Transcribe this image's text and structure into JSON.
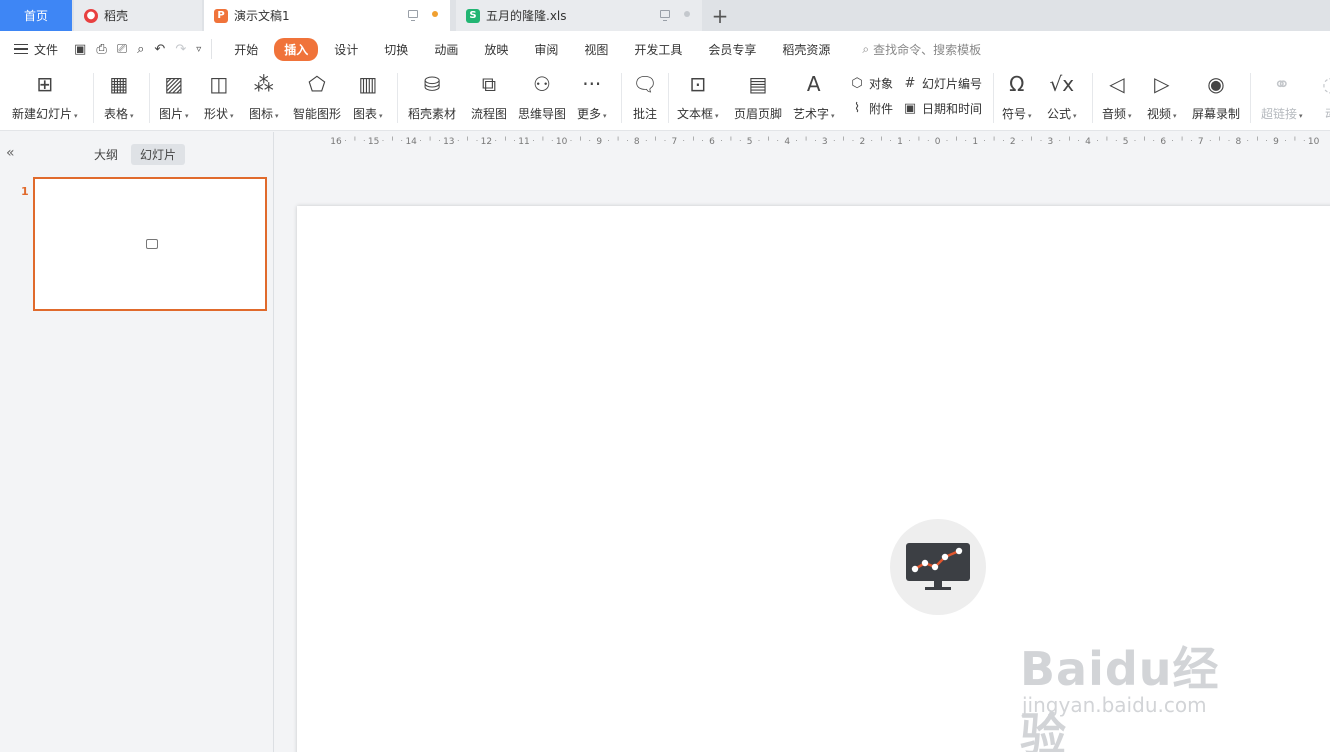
{
  "tabs": [
    {
      "label": "首页",
      "state": "active-home"
    },
    {
      "label": "稻壳",
      "icon": "daoke-icon"
    },
    {
      "label": "演示文稿1",
      "icon": "ppt-icon",
      "state": "current"
    },
    {
      "label": "五月的隆隆.xls",
      "icon": "xls-icon"
    }
  ],
  "menu": {
    "file_label": "文件",
    "tabs": [
      "开始",
      "插入",
      "设计",
      "切换",
      "动画",
      "放映",
      "审阅",
      "视图",
      "开发工具",
      "会员专享",
      "稻壳资源"
    ],
    "active_tab": "插入",
    "search_placeholder": "查找命令、搜索模板"
  },
  "ribbon": {
    "new_slide": "新建幻灯片",
    "table": "表格",
    "picture": "图片",
    "shape": "形状",
    "icon": "图标",
    "smartart": "智能图形",
    "chart": "图表",
    "daoke_material": "稻壳素材",
    "flowchart": "流程图",
    "mindmap": "思维导图",
    "more": "更多",
    "comment": "批注",
    "textbox": "文本框",
    "header_footer": "页眉页脚",
    "wordart": "艺术字",
    "object": "对象",
    "attachment": "附件",
    "slide_number": "幻灯片编号",
    "date_time": "日期和时间",
    "symbol": "符号",
    "formula": "公式",
    "audio": "音频",
    "video": "视频",
    "screen_record": "屏幕录制",
    "hyperlink": "超链接",
    "action": "动"
  },
  "left_panel": {
    "tab_outline": "大纲",
    "tab_slides": "幻灯片",
    "active_tab": "幻灯片",
    "slide_number": "1"
  },
  "ruler": {
    "labels": [
      "16",
      "15",
      "14",
      "13",
      "12",
      "11",
      "10",
      "9",
      "8",
      "7",
      "6",
      "5",
      "4",
      "3",
      "2",
      "1",
      "0",
      "1",
      "2",
      "3",
      "4",
      "5",
      "6",
      "7",
      "8",
      "9",
      "10"
    ]
  },
  "watermark": {
    "main": "Baidu经验",
    "sub": "jingyan.baidu.com"
  },
  "colors": {
    "accent": "#f0733a",
    "home_tab": "#3e86f5",
    "selection_border": "#e06a2c"
  }
}
